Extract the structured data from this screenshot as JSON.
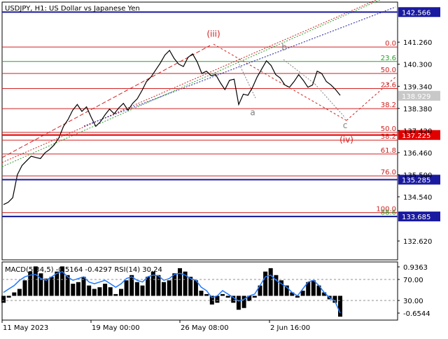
{
  "chart_data": [
    {
      "type": "line",
      "symbol": "USDJPY",
      "timeframe": "H1",
      "description": "US Dollar vs Japanese Yen",
      "title": "USDJPY, H1:  US Dollar vs Japanese Yen",
      "ylim": [
        131.8,
        143.0
      ],
      "y_ticks": [
        "141.260",
        "140.300",
        "139.340",
        "138.380",
        "137.420",
        "136.460",
        "135.500",
        "134.540",
        "132.620"
      ],
      "current_price": "138.929",
      "price_tags": [
        {
          "label": "142.566",
          "value": 142.566,
          "color": "#1a1aa0"
        },
        {
          "label": "137.225",
          "value": 137.225,
          "color": "#e00000"
        },
        {
          "label": "135.285",
          "value": 135.285,
          "color": "#1a1aa0"
        },
        {
          "label": "133.685",
          "value": 133.685,
          "color": "#1a1aa0"
        }
      ],
      "fib_levels": [
        {
          "label": "0.0",
          "value": 141.05,
          "color": "#d02020"
        },
        {
          "label": "23.6",
          "value": 140.42,
          "color": "#2aa02a"
        },
        {
          "label": "50.0",
          "value": 139.9,
          "color": "#d02020"
        },
        {
          "label": "23.6",
          "value": 139.24,
          "color": "#d02020"
        },
        {
          "label": "38.2",
          "value": 138.37,
          "color": "#d02020"
        },
        {
          "label": "50.0",
          "value": 137.34,
          "color": "#d02020"
        },
        {
          "label": "38.2",
          "value": 137.0,
          "color": "#d02020"
        },
        {
          "label": "61.8",
          "value": 136.4,
          "color": "#d02020"
        },
        {
          "label": "76.0",
          "value": 135.45,
          "color": "#d02020"
        },
        {
          "label": "100.0",
          "value": 133.85,
          "color": "#d02020"
        },
        {
          "label": "88.6",
          "value": 133.7,
          "color": "#2aa02a"
        }
      ],
      "wave_labels": [
        {
          "text": "(iii)",
          "value": 141.5,
          "color": "#d02020"
        },
        {
          "text": "b",
          "value": 140.92,
          "color": "#808080"
        },
        {
          "text": "a",
          "value": 138.08,
          "color": "#808080"
        },
        {
          "text": "c",
          "value": 137.52,
          "color": "#808080"
        },
        {
          "text": "(iv)",
          "value": 136.9,
          "color": "#d02020"
        }
      ],
      "x_labels": [
        "11 May 2023",
        "19 May 00:00",
        "26 May 08:00",
        "2 Jun 16:00"
      ],
      "series": [
        {
          "values": [
            134.2,
            134.3,
            134.5,
            135.5,
            135.9,
            136.1,
            136.3,
            136.25,
            136.2,
            136.45,
            136.6,
            136.8,
            137.1,
            137.6,
            137.9,
            138.3,
            138.55,
            138.25,
            138.45,
            138.0,
            137.6,
            137.8,
            138.1,
            138.35,
            138.15,
            138.4,
            138.6,
            138.3,
            138.6,
            138.8,
            139.15,
            139.55,
            139.75,
            140.05,
            140.35,
            140.7,
            140.9,
            140.55,
            140.3,
            140.2,
            140.6,
            140.75,
            140.4,
            139.9,
            140.0,
            139.8,
            139.85,
            139.5,
            139.2,
            139.6,
            139.65,
            138.55,
            139.0,
            138.95,
            139.3,
            139.75,
            140.1,
            140.45,
            140.25,
            139.85,
            139.7,
            139.4,
            139.3,
            139.55,
            139.85,
            139.6,
            139.3,
            139.4,
            140.0,
            139.9,
            139.55,
            139.4,
            139.2,
            138.95
          ]
        }
      ]
    },
    {
      "type": "line",
      "title": "MACD(5,34,5) -0.5164 -0.4297 RSI(14) 30.24",
      "ylim": [
        -0.7,
        0.98
      ],
      "y_ticks": [
        "0.9363",
        "70.00",
        "30.00",
        "-0.6544"
      ],
      "series": [
        {
          "name": "MACD histogram",
          "values": [
            -0.2,
            -0.05,
            0.1,
            0.2,
            0.45,
            0.7,
            0.85,
            0.65,
            0.5,
            0.55,
            0.7,
            0.85,
            0.6,
            0.35,
            0.4,
            0.55,
            0.3,
            0.2,
            0.25,
            0.35,
            0.25,
            0.05,
            0.2,
            0.45,
            0.6,
            0.4,
            0.3,
            0.55,
            0.7,
            0.6,
            0.4,
            0.45,
            0.65,
            0.8,
            0.7,
            0.55,
            0.45,
            0.15,
            0.05,
            -0.25,
            -0.2,
            0.05,
            -0.05,
            -0.2,
            -0.4,
            -0.35,
            -0.15,
            -0.05,
            0.3,
            0.7,
            0.8,
            0.6,
            0.45,
            0.3,
            0.1,
            -0.05,
            0.15,
            0.4,
            0.45,
            0.3,
            0.1,
            -0.1,
            -0.2,
            -0.6
          ]
        },
        {
          "name": "RSI(14)",
          "values": [
            0.1,
            0.2,
            0.3,
            0.45,
            0.55,
            0.6,
            0.62,
            0.5,
            0.45,
            0.55,
            0.65,
            0.7,
            0.55,
            0.45,
            0.5,
            0.55,
            0.4,
            0.35,
            0.4,
            0.45,
            0.35,
            0.25,
            0.35,
            0.5,
            0.55,
            0.45,
            0.4,
            0.55,
            0.6,
            0.58,
            0.45,
            0.5,
            0.62,
            0.65,
            0.6,
            0.5,
            0.45,
            0.25,
            0.15,
            -0.05,
            0.0,
            0.15,
            0.05,
            -0.05,
            -0.15,
            -0.1,
            0.0,
            0.05,
            0.3,
            0.55,
            0.6,
            0.45,
            0.35,
            0.25,
            0.1,
            0.0,
            0.2,
            0.4,
            0.45,
            0.3,
            0.1,
            -0.05,
            -0.15,
            -0.5
          ]
        }
      ]
    }
  ],
  "colors": {
    "price_line": "#000000",
    "blue_level": "#1a1aa0",
    "red_level": "#e00000",
    "fib_red": "#d02020",
    "fib_green": "#2aa02a",
    "rsi_line": "#1e78ff",
    "macd_bar": "#000000"
  }
}
